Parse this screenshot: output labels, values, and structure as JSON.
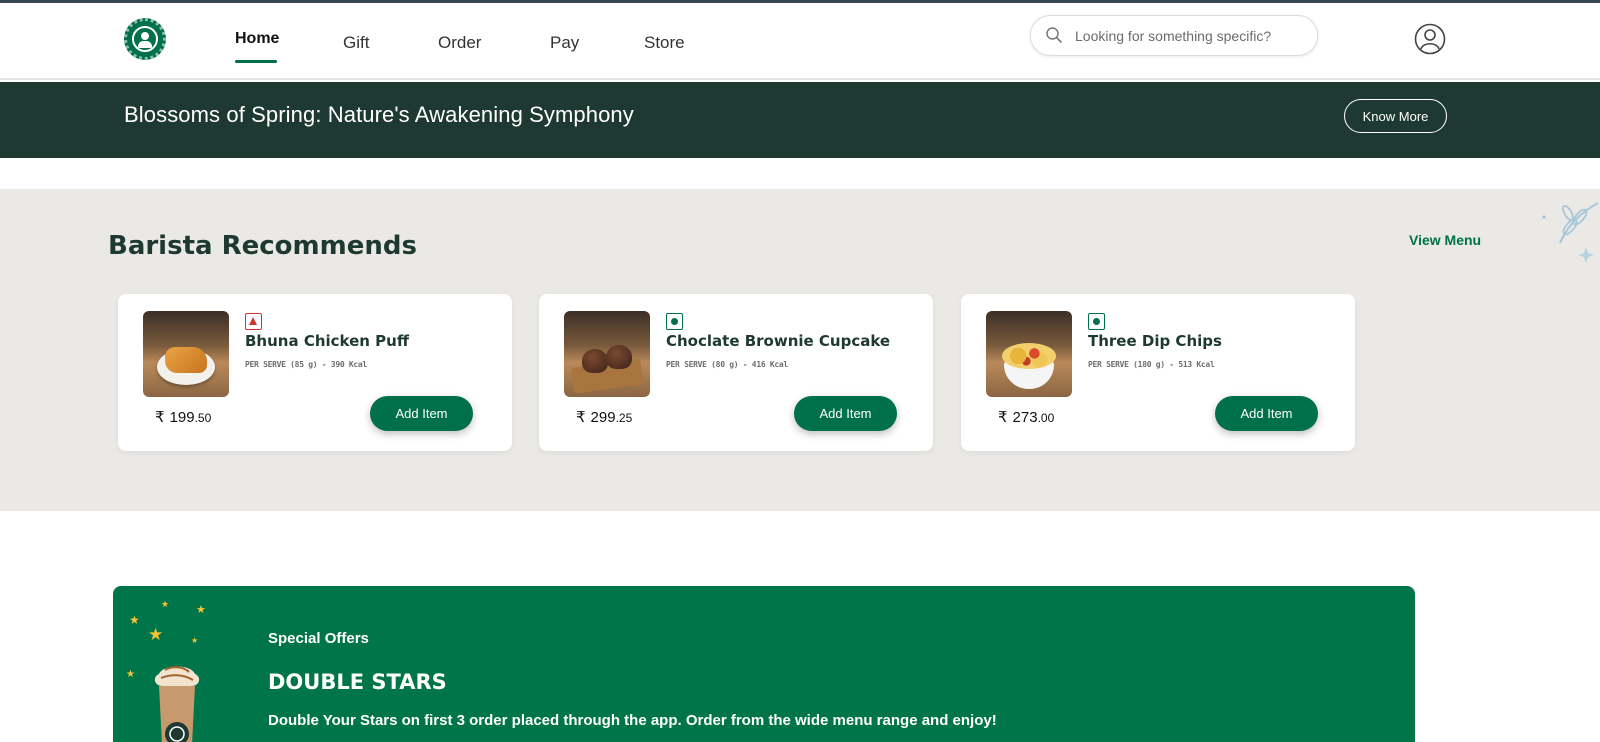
{
  "header": {
    "logo_icon": "starbucks-logo-icon",
    "nav": [
      {
        "label": "Home",
        "active": true
      },
      {
        "label": "Gift"
      },
      {
        "label": "Order"
      },
      {
        "label": "Pay"
      },
      {
        "label": "Store"
      }
    ],
    "search": {
      "placeholder": "Looking for something specific?",
      "value": "",
      "icon": "search-icon"
    },
    "account_icon": "user-account-icon"
  },
  "banner": {
    "title": "Blossoms of Spring: Nature's Awakening Symphony",
    "button_label": "Know More"
  },
  "barista": {
    "title": "Barista Recommends",
    "view_menu_label": "View Menu",
    "items": [
      {
        "name": "Bhuna Chicken Puff",
        "diet": "non-veg",
        "serve": "PER SERVE (85 g) - 390 Kcal",
        "currency": "₹",
        "price_whole": "199",
        "price_decimal": ".50",
        "button_label": "Add Item"
      },
      {
        "name": "Choclate Brownie Cupcake",
        "diet": "veg",
        "serve": "PER SERVE (80 g) - 416 Kcal",
        "currency": "₹",
        "price_whole": "299",
        "price_decimal": ".25",
        "button_label": "Add Item"
      },
      {
        "name": "Three Dip Chips",
        "diet": "veg",
        "serve": "PER SERVE (180 g) - 513 Kcal",
        "currency": "₹",
        "price_whole": "273",
        "price_decimal": ".00",
        "button_label": "Add Item"
      }
    ]
  },
  "offers": {
    "label": "Special Offers",
    "title": "DOUBLE STARS",
    "description": "Double Your Stars on first 3 order placed through the app. Order from the wide menu range and enjoy!"
  },
  "colors": {
    "brand_green": "#00704a",
    "house_green": "#1e3932",
    "section_bg": "#ebe9e6",
    "star_gold": "#f4c430",
    "non_veg_red": "#d0342c"
  }
}
